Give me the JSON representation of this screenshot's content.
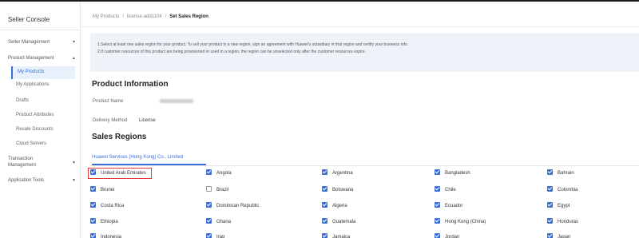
{
  "sidebar": {
    "title": "Seller Console",
    "items": [
      {
        "label": "Seller Management",
        "chevron": "▾"
      },
      {
        "label": "Product Management",
        "chevron": "▴"
      },
      {
        "label": "Transaction Management",
        "chevron": "▾"
      },
      {
        "label": "Application Tools",
        "chevron": "▾"
      }
    ],
    "subitems": [
      "My Products",
      "My Applications",
      "Drafts",
      "Product Attributes",
      "Resale Discounts",
      "Cloud Servers"
    ]
  },
  "breadcrumb": {
    "root": "My Products",
    "mid": "license-add1104",
    "current": "Set Sales Region"
  },
  "notice": {
    "line1": "1.Select at least one sales region for your product. To sell your product in a new region, sign an agreement with Huawei's subsidiary in that region and certify your business info.",
    "line2": "2.If customer resources of this product are being provisioned or used in a region, the region can be unselected only after the customer resources expire."
  },
  "product_info": {
    "heading": "Product Information",
    "name_label": "Product Name",
    "delivery_label": "Delivery Method",
    "delivery_value": "License"
  },
  "sales_regions": {
    "heading": "Sales Regions",
    "tab": "Huawei Services (Hong Kong) Co., Limited",
    "rows": [
      [
        {
          "name": "United Arab Emirates",
          "checked": true
        },
        {
          "name": "Angola",
          "checked": true
        },
        {
          "name": "Argentina",
          "checked": true
        },
        {
          "name": "Bangladesh",
          "checked": true
        },
        {
          "name": "Bahrain",
          "checked": true
        }
      ],
      [
        {
          "name": "Brunei",
          "checked": true
        },
        {
          "name": "Brazil",
          "checked": false
        },
        {
          "name": "Botswana",
          "checked": true
        },
        {
          "name": "Chile",
          "checked": true
        },
        {
          "name": "Colombia",
          "checked": true
        }
      ],
      [
        {
          "name": "Costa Rica",
          "checked": true
        },
        {
          "name": "Dominican Republic",
          "checked": true
        },
        {
          "name": "Algeria",
          "checked": true
        },
        {
          "name": "Ecuador",
          "checked": true
        },
        {
          "name": "Egypt",
          "checked": true
        }
      ],
      [
        {
          "name": "Ethiopia",
          "checked": true
        },
        {
          "name": "Ghana",
          "checked": true
        },
        {
          "name": "Guatemala",
          "checked": true
        },
        {
          "name": "Hong Kong (China)",
          "checked": true
        },
        {
          "name": "Honduras",
          "checked": true
        }
      ],
      [
        {
          "name": "Indonesia",
          "checked": true
        },
        {
          "name": "Iraq",
          "checked": true
        },
        {
          "name": "Jamaica",
          "checked": true
        },
        {
          "name": "Jordan",
          "checked": true
        },
        {
          "name": "Japan",
          "checked": true
        }
      ]
    ]
  },
  "colors": {
    "accent": "#3a6fd8",
    "highlight": "#e03b3b"
  }
}
